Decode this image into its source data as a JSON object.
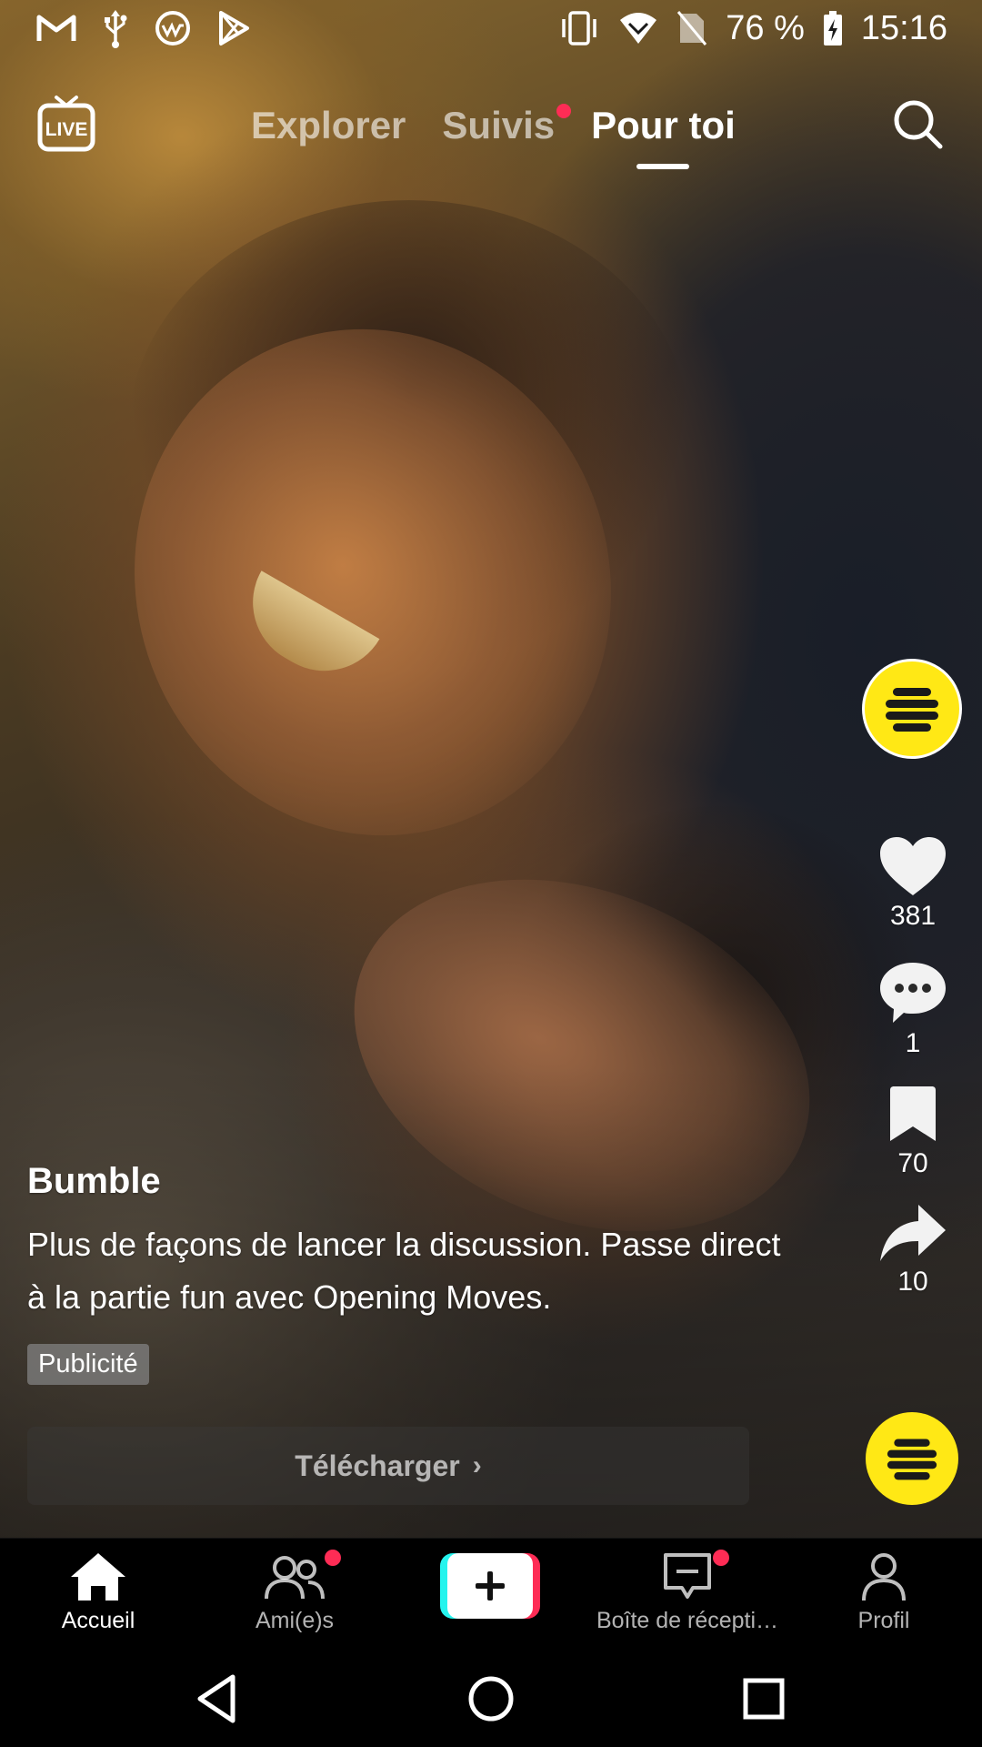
{
  "status_bar": {
    "left_icons": [
      "gmail-icon",
      "usb-icon",
      "vpn-icon",
      "play-store-icon"
    ],
    "right_icons": [
      "vibrate-icon",
      "wifi-icon",
      "no-sim-icon",
      "battery-charging-icon"
    ],
    "battery_percent": "76 %",
    "time": "15:16"
  },
  "top_nav": {
    "live_label": "LIVE",
    "tabs": [
      {
        "label": "Explorer",
        "active": false,
        "dot": false
      },
      {
        "label": "Suivis",
        "active": false,
        "dot": true
      },
      {
        "label": "Pour toi",
        "active": true,
        "dot": false
      }
    ]
  },
  "video": {
    "author": "Bumble",
    "description": "Plus de façons de lancer la discussion. Passe direct à la partie fun avec Opening Moves.",
    "ad_badge": "Publicité",
    "download_label": "Télécharger",
    "download_chevron": "›"
  },
  "actions": {
    "likes": "381",
    "comments": "1",
    "saves": "70",
    "shares": "10"
  },
  "colors": {
    "accent_red": "#fe2c55",
    "accent_cyan": "#25f4ee",
    "bumble_yellow": "#ffe815"
  },
  "bottom_nav": {
    "items": [
      {
        "label": "Accueil",
        "icon": "home-icon",
        "active": true
      },
      {
        "label": "Ami(e)s",
        "icon": "friends-icon",
        "active": false,
        "dot": true
      },
      {
        "label": "",
        "icon": "create-plus-icon",
        "active": false
      },
      {
        "label": "Boîte de récepti…",
        "icon": "inbox-icon",
        "active": false,
        "dot": true
      },
      {
        "label": "Profil",
        "icon": "profile-icon",
        "active": false
      }
    ]
  },
  "android_nav": [
    "back-icon",
    "home-circle-icon",
    "recents-icon"
  ]
}
